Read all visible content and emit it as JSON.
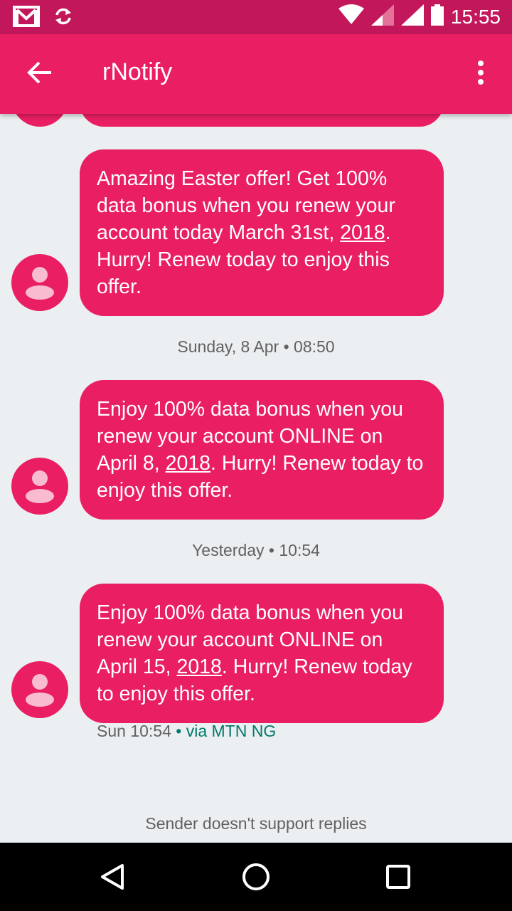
{
  "status_bar": {
    "time": "15:55",
    "left_icons": [
      "gmail-icon",
      "sync-icon"
    ],
    "right_icons": [
      "wifi-icon",
      "signal-icon",
      "signal-icon",
      "battery-icon"
    ]
  },
  "app_bar": {
    "title": "rNotify",
    "back_icon": "arrow-left-icon",
    "menu_icon": "more-vert-icon"
  },
  "messages": [
    {
      "text_parts": [
        "Amazing Easter offer! Get 100% data bonus when you renew your account today March 31st, ",
        "2018",
        ". Hurry! Renew today to enjoy this offer."
      ]
    },
    {
      "stamp": "Sunday, 8 Apr • 08:50",
      "text_parts": [
        "Enjoy 100% data bonus when you renew your account ONLINE on April 8, ",
        "2018",
        ". Hurry! Renew today to enjoy this offer."
      ]
    },
    {
      "stamp": "Yesterday • 10:54",
      "text_parts": [
        "Enjoy 100% data bonus when you renew your account ONLINE on April 15, ",
        "2018",
        ". Hurry! Renew today to enjoy this offer."
      ],
      "meta_time": "Sun 10:54",
      "meta_separator": " • ",
      "meta_via": "via MTN NG"
    }
  ],
  "footer_note": "Sender doesn't support replies",
  "nav_bar": {
    "icons": [
      "back-triangle-icon",
      "home-circle-icon",
      "recents-square-icon"
    ]
  },
  "colors": {
    "accent": "#e91e63",
    "status_bar": "#c2185b",
    "background": "#eceff1",
    "via_text": "#00796b"
  }
}
